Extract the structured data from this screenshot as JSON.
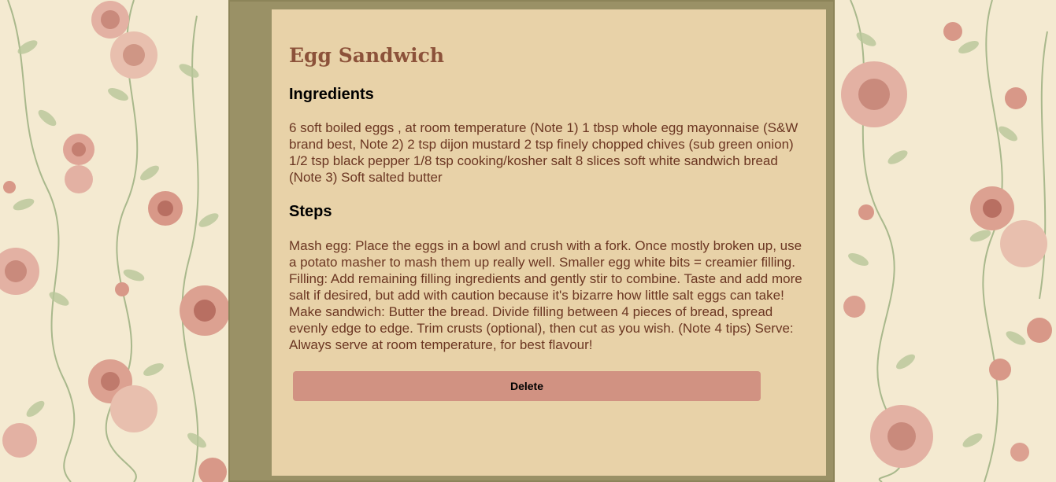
{
  "recipe": {
    "title": "Egg Sandwich",
    "ingredients_heading": "Ingredients",
    "ingredients_text": "6 soft boiled eggs , at room temperature (Note 1) 1 tbsp whole egg mayonnaise (S&W brand best, Note 2) 2 tsp dijon mustard 2 tsp finely chopped chives (sub green onion) 1/2 tsp black pepper 1/8 tsp cooking/kosher salt 8 slices soft white sandwich bread (Note 3) Soft salted butter",
    "steps_heading": "Steps",
    "steps_text": "Mash egg: Place the eggs in a bowl and crush with a fork. Once mostly broken up, use a potato masher to mash them up really well. Smaller egg white bits = creamier filling. Filling: Add remaining filling ingredients and gently stir to combine. Taste and add more salt if desired, but add with caution because it's bizarre how little salt eggs can take! Make sandwich: Butter the bread. Divide filling between 4 pieces of bread, spread evenly edge to edge. Trim crusts (optional), then cut as you wish. (Note 4 tips) Serve: Always serve at room temperature, for best flavour!",
    "delete_label": "Delete"
  },
  "colors": {
    "frame": "#9a9166",
    "card": "#e8d2a8",
    "title": "#8c523a",
    "body_text": "#6b3622",
    "delete_button": "#d19282",
    "wallpaper": "#f4ead1"
  }
}
